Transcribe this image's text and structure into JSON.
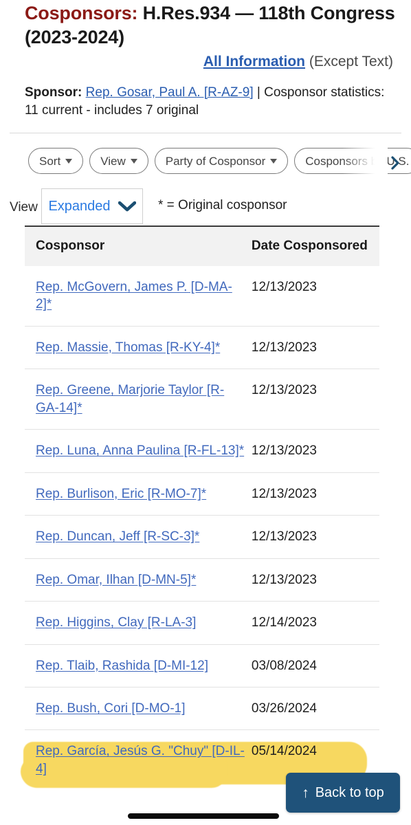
{
  "header": {
    "title_prefix": "Cosponsors:",
    "title_rest": " H.Res.934 — 118th Congress (2023-2024)",
    "all_information_link": "All Information",
    "all_information_suffix": " (Except Text)",
    "sponsor_label": "Sponsor:",
    "sponsor_link": "Rep. Gosar, Paul A. [R-AZ-9]",
    "sponsor_stats": " | Cosponsor statistics: 11 current - includes 7 original"
  },
  "filters": {
    "chips": [
      {
        "label": "Sort",
        "has_caret": true
      },
      {
        "label": "View",
        "has_caret": true
      },
      {
        "label": "Party of Cosponsor",
        "has_caret": true
      },
      {
        "label": "Cosponsors by U.S.",
        "has_caret": false
      }
    ],
    "next_icon": "chevron-right-icon"
  },
  "view_control": {
    "label": "View",
    "selected": "Expanded",
    "caret_icon": "chevron-down-icon",
    "original_note": "* = Original cosponsor"
  },
  "table": {
    "columns": [
      "Cosponsor",
      "Date Cosponsored"
    ],
    "rows": [
      {
        "name": "Rep. McGovern, James P. [D-MA-2]*",
        "date": "12/13/2023",
        "highlighted": false
      },
      {
        "name": "Rep. Massie, Thomas [R-KY-4]*",
        "date": "12/13/2023",
        "highlighted": false
      },
      {
        "name": "Rep. Greene, Marjorie Taylor [R-GA-14]*",
        "date": "12/13/2023",
        "highlighted": false
      },
      {
        "name": "Rep. Luna, Anna Paulina [R-FL-13]*",
        "date": "12/13/2023",
        "highlighted": false
      },
      {
        "name": "Rep. Burlison, Eric [R-MO-7]*",
        "date": "12/13/2023",
        "highlighted": false
      },
      {
        "name": "Rep. Duncan, Jeff [R-SC-3]*",
        "date": "12/13/2023",
        "highlighted": false
      },
      {
        "name": "Rep. Omar, Ilhan [D-MN-5]*",
        "date": "12/13/2023",
        "highlighted": false
      },
      {
        "name": "Rep. Higgins, Clay [R-LA-3]",
        "date": "12/14/2023",
        "highlighted": false
      },
      {
        "name": "Rep. Tlaib, Rashida [D-MI-12]",
        "date": "03/08/2024",
        "highlighted": false
      },
      {
        "name": "Rep. Bush, Cori [D-MO-1]",
        "date": "03/26/2024",
        "highlighted": false
      },
      {
        "name": "Rep. García, Jesús G. \"Chuy\" [D-IL-4]",
        "date": "05/14/2024",
        "highlighted": true
      }
    ]
  },
  "back_to_top": {
    "label": "Back to top",
    "icon": "arrow-up-icon",
    "arrow_glyph": "↑"
  },
  "colors": {
    "title_accent": "#8b1a16",
    "link_blue": "#2a5db0",
    "table_link_blue": "#4169bd",
    "highlight_yellow": "#f7d860",
    "button_blue": "#1f527a",
    "header_gray": "#f2f2f2"
  }
}
